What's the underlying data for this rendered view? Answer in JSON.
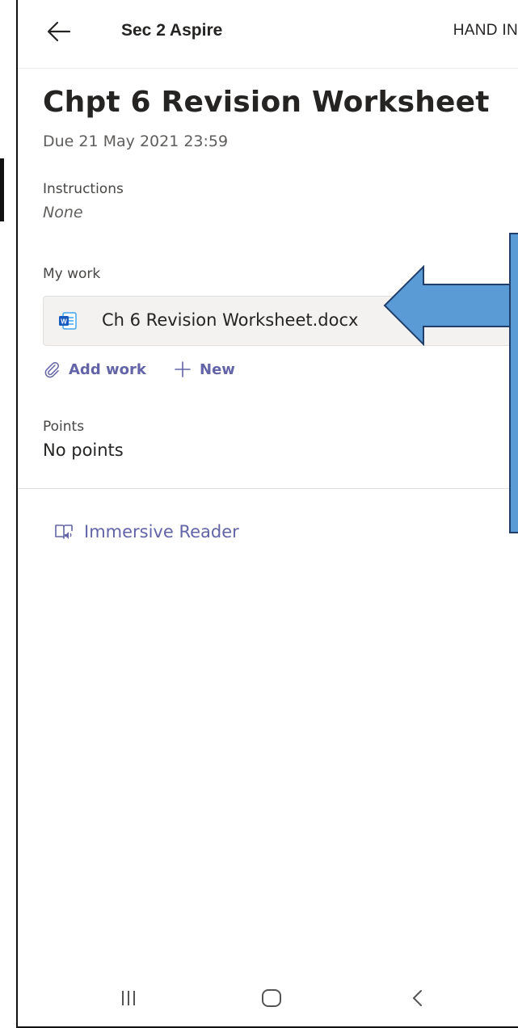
{
  "header": {
    "class_name": "Sec 2 Aspire",
    "hand_in_label": "HAND IN",
    "back_icon": "arrow-left-icon"
  },
  "assignment": {
    "title": "Chpt 6 Revision Worksheet",
    "due": "Due 21 May 2021 23:59"
  },
  "instructions": {
    "label": "Instructions",
    "value": "None"
  },
  "my_work": {
    "label": "My work",
    "file": {
      "name": "Ch 6 Revision Worksheet.docx",
      "icon": "word-doc-icon"
    },
    "add_work_label": "Add work",
    "new_label": "New"
  },
  "points": {
    "label": "Points",
    "value": "No points"
  },
  "immersive_reader": {
    "label": "Immersive Reader",
    "icon": "immersive-reader-icon"
  },
  "colors": {
    "accent": "#6264a7",
    "annotation_fill": "#5b9bd5",
    "annotation_stroke": "#1f3f6a"
  },
  "system_nav": {
    "recents_icon": "recents-icon",
    "home_icon": "home-icon",
    "back_icon": "back-chevron-icon"
  }
}
